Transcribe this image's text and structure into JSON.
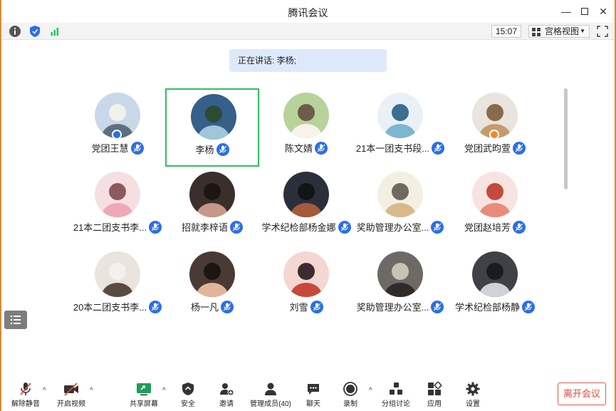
{
  "window": {
    "title": "腾讯会议"
  },
  "infobar": {
    "clock": "15:07",
    "view_label": "宫格视图"
  },
  "speaking": "正在讲话: 李杨;",
  "participants": [
    {
      "name": "党团王慧"
    },
    {
      "name": "李杨"
    },
    {
      "name": "陈文婧"
    },
    {
      "name": "21本一团支书段..."
    },
    {
      "name": "党团武昀萱"
    },
    {
      "name": "21本二团支书李..."
    },
    {
      "name": "招就李梓语"
    },
    {
      "name": "学术纪检部杨金娜"
    },
    {
      "name": "奖助管理办公室..."
    },
    {
      "name": "党团赵培芳"
    },
    {
      "name": "20本二团支书李..."
    },
    {
      "name": "杨一凡"
    },
    {
      "name": "刘雪"
    },
    {
      "name": "奖助管理办公室..."
    },
    {
      "name": "学术纪检部杨静"
    }
  ],
  "toolbar": {
    "unmute": "解除静音",
    "start_video": "开启视频",
    "share_screen": "共享屏幕",
    "security": "安全",
    "invite": "邀请",
    "manage_members": "管理成员(40)",
    "chat": "聊天",
    "record": "录制",
    "breakout": "分组讨论",
    "apps": "应用",
    "settings": "设置",
    "leave": "离开会议"
  },
  "colors": {
    "accent": "#2a6ee8",
    "active_border": "#2fbf62",
    "leave": "#e04a3a",
    "speaking_bg": "#dde9fb"
  }
}
